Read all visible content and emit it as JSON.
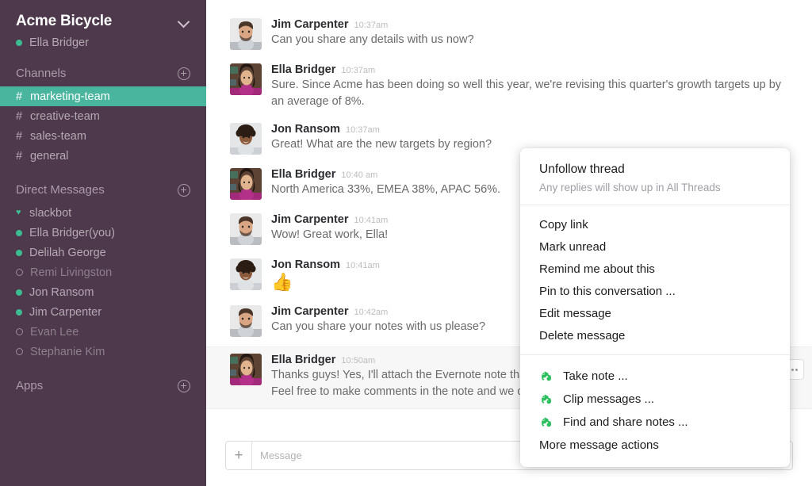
{
  "sidebar": {
    "team_name": "Acme Bicycle",
    "team_chevron_icon": "chevron-down-icon",
    "current_user": "Ella Bridger",
    "channels_section": {
      "title": "Channels",
      "add_icon": "plus-circle-icon"
    },
    "channels": [
      {
        "hash": "#",
        "label": "marketing-team",
        "active": true
      },
      {
        "hash": "#",
        "label": "creative-team",
        "active": false
      },
      {
        "hash": "#",
        "label": "sales-team",
        "active": false
      },
      {
        "hash": "#",
        "label": "general",
        "active": false
      }
    ],
    "dm_section": {
      "title": "Direct Messages",
      "add_icon": "plus-circle-icon"
    },
    "dms": [
      {
        "label": "slackbot",
        "presence": "heart",
        "muted": false
      },
      {
        "label": "Ella Bridger(you)",
        "presence": "online",
        "muted": false
      },
      {
        "label": "Delilah George",
        "presence": "online",
        "muted": false
      },
      {
        "label": "Remi Livingston",
        "presence": "away",
        "muted": true
      },
      {
        "label": "Jon Ransom",
        "presence": "online",
        "muted": false
      },
      {
        "label": "Jim Carpenter",
        "presence": "online",
        "muted": false
      },
      {
        "label": "Evan Lee",
        "presence": "away",
        "muted": true
      },
      {
        "label": "Stephanie Kim",
        "presence": "away",
        "muted": true
      }
    ],
    "apps_section": {
      "title": "Apps",
      "add_icon": "plus-circle-icon"
    },
    "colors": {
      "background": "#4d394b",
      "active_channel": "#4ab59e",
      "presence_online": "#3dbb91",
      "text": "#b6a8b4"
    }
  },
  "messages": [
    {
      "author": "Jim Carpenter",
      "time": "10:37am",
      "text": "Can you share any details with us now?",
      "avatar": "jim-carpenter-avatar",
      "highlighted": false
    },
    {
      "author": "Ella Bridger",
      "time": "10:37am",
      "text": "Sure. Since Acme has been doing so well this year, we're revising this quarter's growth targets up by an average of 8%.",
      "avatar": "ella-bridger-avatar",
      "highlighted": false
    },
    {
      "author": "Jon Ransom",
      "time": "10:37am",
      "text": "Great! What are the new targets by region?",
      "avatar": "jon-ransom-avatar",
      "highlighted": false
    },
    {
      "author": "Ella Bridger",
      "time": "10:40 am",
      "text": "North America 33%, EMEA 38%, APAC 56%.",
      "avatar": "ella-bridger-avatar",
      "highlighted": false
    },
    {
      "author": "Jim Carpenter",
      "time": "10:41am",
      "text": "Wow! Great work, Ella!",
      "avatar": "jim-carpenter-avatar",
      "highlighted": false
    },
    {
      "author": "Jon Ransom",
      "time": "10:41am",
      "text": "👍",
      "emoji": true,
      "avatar": "jon-ransom-avatar",
      "highlighted": false
    },
    {
      "author": "Jim Carpenter",
      "time": "10:42am",
      "text": "Can you share your notes with us please?",
      "avatar": "jim-carpenter-avatar",
      "highlighted": false
    },
    {
      "author": "Ella Bridger",
      "time": "10:50am",
      "text": "Thanks guys! Yes, I'll attach the Evernote note that ex",
      "text2": "Feel free to make comments in the note and we can",
      "avatar": "ella-bridger-avatar",
      "highlighted": true
    }
  ],
  "composer": {
    "plus_icon": "plus-icon",
    "placeholder": "Message",
    "value": "",
    "emoji_icon": "emoji-smiley-icon"
  },
  "more_actions_button": {
    "name": "more-message-actions-button",
    "icon": "ellipsis-icon"
  },
  "context_menu": {
    "primary": {
      "title": "Unfollow thread",
      "subtitle": "Any replies will show up in All Threads"
    },
    "actions": [
      {
        "label": "Copy link",
        "icon": null
      },
      {
        "label": "Mark unread",
        "icon": null
      },
      {
        "label": "Remind me about this",
        "icon": null
      },
      {
        "label": "Pin to this conversation ...",
        "icon": null
      },
      {
        "label": "Edit message",
        "icon": null
      },
      {
        "label": "Delete message",
        "icon": null
      }
    ],
    "integration_actions": [
      {
        "label": "Take note ...",
        "icon": "evernote-icon"
      },
      {
        "label": "Clip messages ...",
        "icon": "evernote-icon"
      },
      {
        "label": "Find and share notes ...",
        "icon": "evernote-icon"
      },
      {
        "label": "More message actions",
        "icon": null
      }
    ],
    "colors": {
      "evernote_green": "#2dbe60",
      "text": "#1d1c1d",
      "subtitle": "#9e9ea6"
    }
  }
}
